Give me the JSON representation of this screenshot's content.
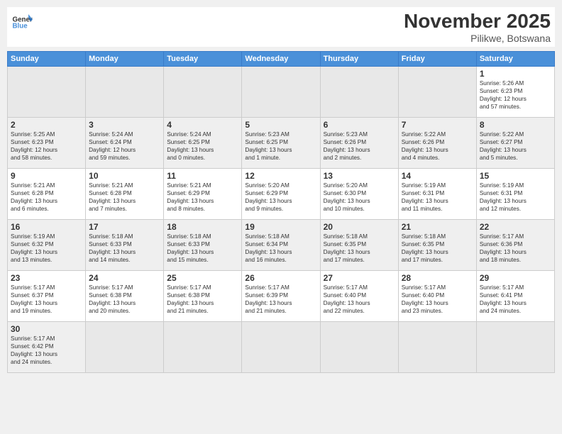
{
  "header": {
    "logo_general": "General",
    "logo_blue": "Blue",
    "month_title": "November 2025",
    "subtitle": "Pilikwe, Botswana"
  },
  "weekdays": [
    "Sunday",
    "Monday",
    "Tuesday",
    "Wednesday",
    "Thursday",
    "Friday",
    "Saturday"
  ],
  "weeks": [
    [
      {
        "day": "",
        "info": ""
      },
      {
        "day": "",
        "info": ""
      },
      {
        "day": "",
        "info": ""
      },
      {
        "day": "",
        "info": ""
      },
      {
        "day": "",
        "info": ""
      },
      {
        "day": "",
        "info": ""
      },
      {
        "day": "1",
        "info": "Sunrise: 5:26 AM\nSunset: 6:23 PM\nDaylight: 12 hours\nand 57 minutes."
      }
    ],
    [
      {
        "day": "2",
        "info": "Sunrise: 5:25 AM\nSunset: 6:23 PM\nDaylight: 12 hours\nand 58 minutes."
      },
      {
        "day": "3",
        "info": "Sunrise: 5:24 AM\nSunset: 6:24 PM\nDaylight: 12 hours\nand 59 minutes."
      },
      {
        "day": "4",
        "info": "Sunrise: 5:24 AM\nSunset: 6:25 PM\nDaylight: 13 hours\nand 0 minutes."
      },
      {
        "day": "5",
        "info": "Sunrise: 5:23 AM\nSunset: 6:25 PM\nDaylight: 13 hours\nand 1 minute."
      },
      {
        "day": "6",
        "info": "Sunrise: 5:23 AM\nSunset: 6:26 PM\nDaylight: 13 hours\nand 2 minutes."
      },
      {
        "day": "7",
        "info": "Sunrise: 5:22 AM\nSunset: 6:26 PM\nDaylight: 13 hours\nand 4 minutes."
      },
      {
        "day": "8",
        "info": "Sunrise: 5:22 AM\nSunset: 6:27 PM\nDaylight: 13 hours\nand 5 minutes."
      }
    ],
    [
      {
        "day": "9",
        "info": "Sunrise: 5:21 AM\nSunset: 6:28 PM\nDaylight: 13 hours\nand 6 minutes."
      },
      {
        "day": "10",
        "info": "Sunrise: 5:21 AM\nSunset: 6:28 PM\nDaylight: 13 hours\nand 7 minutes."
      },
      {
        "day": "11",
        "info": "Sunrise: 5:21 AM\nSunset: 6:29 PM\nDaylight: 13 hours\nand 8 minutes."
      },
      {
        "day": "12",
        "info": "Sunrise: 5:20 AM\nSunset: 6:29 PM\nDaylight: 13 hours\nand 9 minutes."
      },
      {
        "day": "13",
        "info": "Sunrise: 5:20 AM\nSunset: 6:30 PM\nDaylight: 13 hours\nand 10 minutes."
      },
      {
        "day": "14",
        "info": "Sunrise: 5:19 AM\nSunset: 6:31 PM\nDaylight: 13 hours\nand 11 minutes."
      },
      {
        "day": "15",
        "info": "Sunrise: 5:19 AM\nSunset: 6:31 PM\nDaylight: 13 hours\nand 12 minutes."
      }
    ],
    [
      {
        "day": "16",
        "info": "Sunrise: 5:19 AM\nSunset: 6:32 PM\nDaylight: 13 hours\nand 13 minutes."
      },
      {
        "day": "17",
        "info": "Sunrise: 5:18 AM\nSunset: 6:33 PM\nDaylight: 13 hours\nand 14 minutes."
      },
      {
        "day": "18",
        "info": "Sunrise: 5:18 AM\nSunset: 6:33 PM\nDaylight: 13 hours\nand 15 minutes."
      },
      {
        "day": "19",
        "info": "Sunrise: 5:18 AM\nSunset: 6:34 PM\nDaylight: 13 hours\nand 16 minutes."
      },
      {
        "day": "20",
        "info": "Sunrise: 5:18 AM\nSunset: 6:35 PM\nDaylight: 13 hours\nand 17 minutes."
      },
      {
        "day": "21",
        "info": "Sunrise: 5:18 AM\nSunset: 6:35 PM\nDaylight: 13 hours\nand 17 minutes."
      },
      {
        "day": "22",
        "info": "Sunrise: 5:17 AM\nSunset: 6:36 PM\nDaylight: 13 hours\nand 18 minutes."
      }
    ],
    [
      {
        "day": "23",
        "info": "Sunrise: 5:17 AM\nSunset: 6:37 PM\nDaylight: 13 hours\nand 19 minutes."
      },
      {
        "day": "24",
        "info": "Sunrise: 5:17 AM\nSunset: 6:38 PM\nDaylight: 13 hours\nand 20 minutes."
      },
      {
        "day": "25",
        "info": "Sunrise: 5:17 AM\nSunset: 6:38 PM\nDaylight: 13 hours\nand 21 minutes."
      },
      {
        "day": "26",
        "info": "Sunrise: 5:17 AM\nSunset: 6:39 PM\nDaylight: 13 hours\nand 21 minutes."
      },
      {
        "day": "27",
        "info": "Sunrise: 5:17 AM\nSunset: 6:40 PM\nDaylight: 13 hours\nand 22 minutes."
      },
      {
        "day": "28",
        "info": "Sunrise: 5:17 AM\nSunset: 6:40 PM\nDaylight: 13 hours\nand 23 minutes."
      },
      {
        "day": "29",
        "info": "Sunrise: 5:17 AM\nSunset: 6:41 PM\nDaylight: 13 hours\nand 24 minutes."
      }
    ],
    [
      {
        "day": "30",
        "info": "Sunrise: 5:17 AM\nSunset: 6:42 PM\nDaylight: 13 hours\nand 24 minutes."
      },
      {
        "day": "",
        "info": ""
      },
      {
        "day": "",
        "info": ""
      },
      {
        "day": "",
        "info": ""
      },
      {
        "day": "",
        "info": ""
      },
      {
        "day": "",
        "info": ""
      },
      {
        "day": "",
        "info": ""
      }
    ]
  ]
}
